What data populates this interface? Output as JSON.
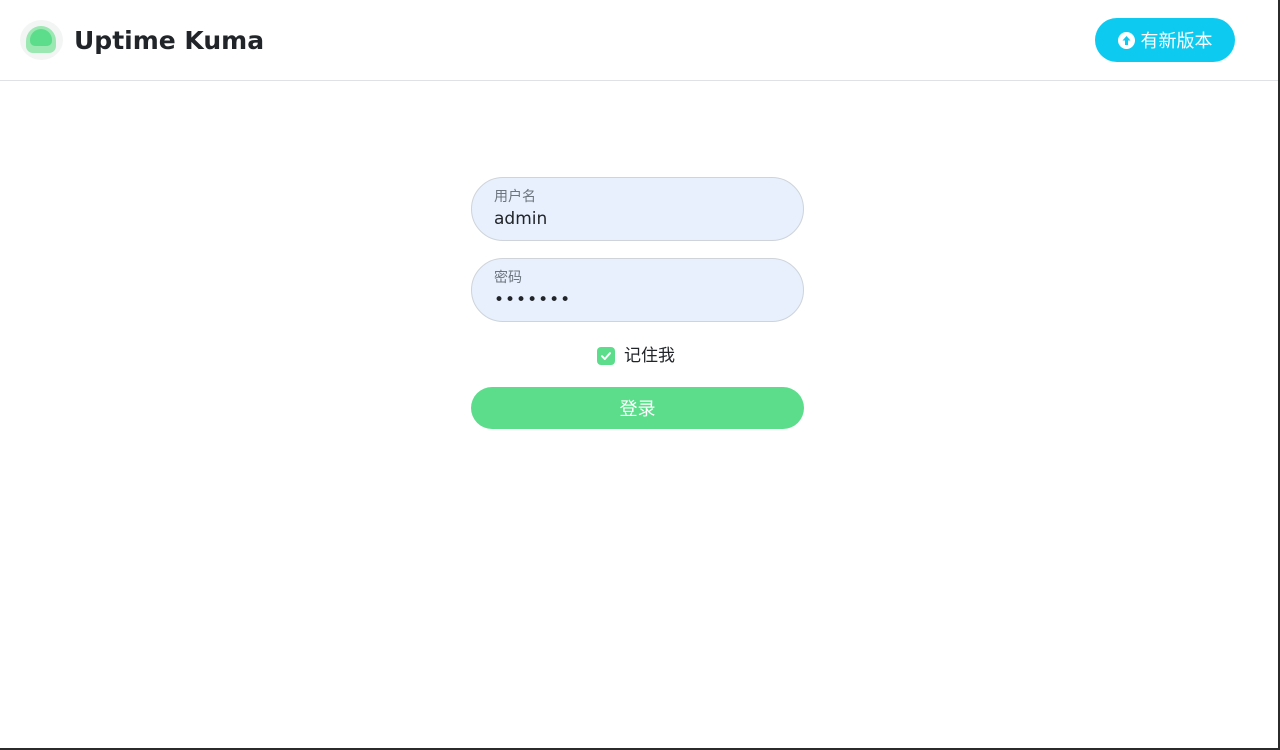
{
  "header": {
    "title": "Uptime Kuma",
    "logo_icon": "uptime-kuma-logo",
    "update_button": {
      "label": "有新版本",
      "icon": "arrow-up-circle-icon",
      "color": "#0dcaf0"
    }
  },
  "login": {
    "username": {
      "label": "用户名",
      "value": "admin"
    },
    "password": {
      "label": "密码",
      "value": "•••••••"
    },
    "remember": {
      "label": "记住我",
      "checked": true,
      "color": "#5cdd8b"
    },
    "submit_label": "登录",
    "accent": "#5cdd8b",
    "field_background": "#e8f0fe"
  }
}
